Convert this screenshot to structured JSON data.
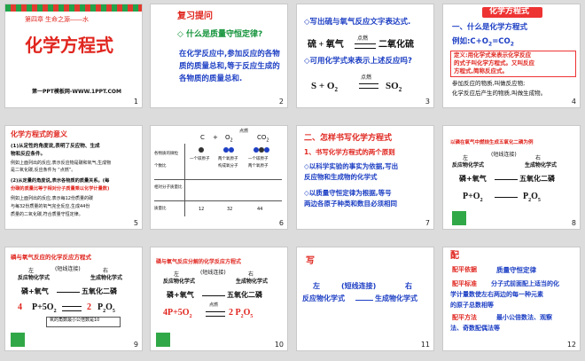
{
  "slides": [
    {
      "num": "1",
      "subtitle": "第四章 生命之源——水",
      "title": "化学方程式",
      "footer": "第一PPT模板网-WWW.1PPT.COM"
    },
    {
      "num": "2",
      "heading": "复习提问",
      "q1": "◇ 什么是质量守恒定律?",
      "a1": "在化学反应中,参加反应的各物",
      "a2": "质的质量总和,等于反应生成的",
      "a3": "各物质的质量总和."
    },
    {
      "num": "3",
      "l1": "◇写出硫与氧气反应文字表达式.",
      "l2a": "硫  +  氧气",
      "l2b": "点燃",
      "l2c": "二氧化硫",
      "l3": "◇可用化学式来表示上述反应吗?",
      "e1": "S  +  O",
      "e2": "2",
      "e3": "点燃",
      "e4": "SO",
      "e5": "2"
    },
    {
      "num": "4",
      "heading": "化学方程式",
      "l1": "一、什么是化学方程式",
      "l2": "例如:C+O",
      "l2s": "2",
      "l2b": "=CO",
      "l2s2": "2",
      "def1": "定义:用化学式来表示化学反应",
      "def2": "的式子叫化学方程式。又叫反应",
      "def3": "方程式,简称反应式。",
      "n1": "参加反应的物质,叫做反应物;",
      "n2": "化学反应后产生的物质,叫做生成物。"
    },
    {
      "num": "5",
      "heading": "化学方程式的意义",
      "p1a": "(1)从定性的角度说,表明了反应物、生成",
      "p1b": "物和反应条件。",
      "p2a": "例如上面列出的反应,表示反应物是碳和氧气,生成物",
      "p2b": "是二氧化碳,反应条件为 “点燃”。",
      "p3a": "(2)从定量的角度说,表示各物质的质量关系。(每",
      "p3b": "份碳的质量比等于相对分子质量乘以化学计量数)",
      "p4a": "例如上面列出的反应,表示每12份质量的碳",
      "p4b": "与每32份质量的氧气完全反应,生成44份",
      "p4c": "质量的二氧化碳,符合质量守恒定律。"
    },
    {
      "num": "6",
      "h1": "C",
      "h2": "+",
      "h3": "O",
      "h3s": "2",
      "h4": "点燃",
      "h5": "CO",
      "h5s": "2",
      "r1": "各物质的微粒",
      "r1a": "一个碳原子",
      "r1b": "两个氧原子",
      "r1c": "一个碳原子",
      "r2": "个数比",
      "r2a": "",
      "r2b": "构成氧分子",
      "r2c": "两个氧原子",
      "r3": "相对分子质量比",
      "r4": "质量比",
      "m1": "12",
      "m2": "32",
      "m3": "44"
    },
    {
      "num": "7",
      "l1": "二、怎样书写化学方程式",
      "l2": "1、书写化学方程式的两个原则",
      "l3": "◇以科学实验的事实为依据,写出",
      "l4": "反应物和生成物的化学式",
      "l5": "◇以质量守恒定律为根据,等号",
      "l6": "两边各原子种类和数目必须相同"
    },
    {
      "num": "8",
      "title": "以磷在氧气中燃烧生成五氧化二磷为例",
      "c1": "左",
      "c2": "(短线连接)",
      "c3": "右",
      "c4": "反应物化学式",
      "c5": "生成物化学式",
      "w1": "磷+氧气",
      "w2": "五氧化二磷",
      "f1": "P+O",
      "f1s": "2",
      "f2": "P",
      "f2s": "2",
      "f3": "O",
      "f3s": "5"
    },
    {
      "num": "9",
      "title": "磷与氧气反应的化学反应方程式",
      "c1": "左",
      "c2": "(短线连接)",
      "c3": "右",
      "c4": "反应物化学式",
      "c5": "生成物化学式",
      "w1": "磷+氧气",
      "w2": "五氧化二磷",
      "f0": "4",
      "f1": "P+5O",
      "f1s": "2",
      "f2": "2",
      "f3": "P",
      "f3s": "2",
      "f4": "O",
      "f4s": "5",
      "note": "氧的角数最小公倍数是10"
    },
    {
      "num": "10",
      "title": "磷与氧气反应分解的化学反应方程式",
      "c1": "左",
      "c2": "(短线连接)",
      "c3": "右",
      "c4": "反应物化学式",
      "c5": "生成物化学式",
      "w1": "磷+氧气",
      "w2": "五氧化二磷",
      "f1": "4P+5O",
      "f1s": "2",
      "fc": "点燃",
      "f2": "2 P",
      "f2s": "2",
      "f3": "O",
      "f3s": "5"
    },
    {
      "num": "11",
      "title": "写",
      "c1": "左",
      "c2": "(短线连接)",
      "c3": "右",
      "c4": "反应物化学式",
      "c5": "生成物化学式"
    },
    {
      "num": "12",
      "title": "配",
      "k1": "配平依据",
      "v1": "质量守恒定律",
      "k2": "配平标准",
      "v2a": "分子式前面配上适当的化",
      "v2b": "学计量数使左右两边的每一种元素",
      "v2c": "的原子总数相等",
      "k3": "配平方法",
      "v3a": "最小公倍数法、观察",
      "v3b": "法、奇数配偶法等"
    }
  ]
}
